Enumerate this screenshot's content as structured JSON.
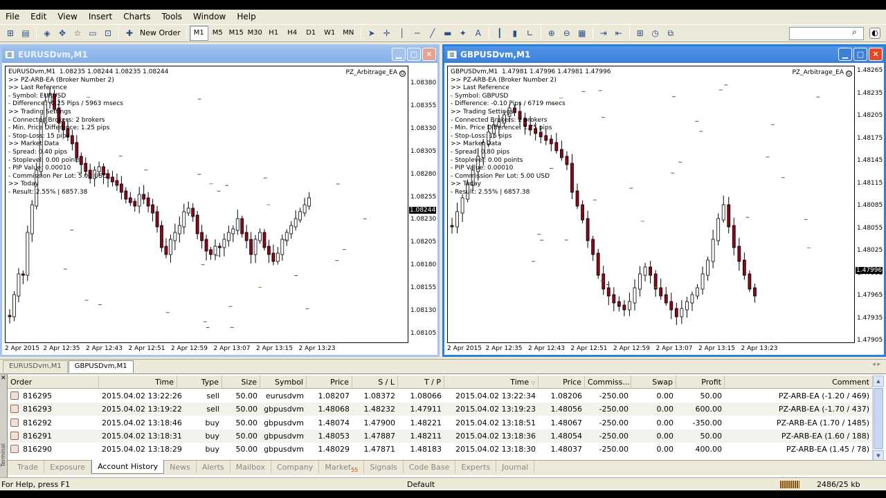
{
  "menu": [
    "File",
    "Edit",
    "View",
    "Insert",
    "Charts",
    "Tools",
    "Window",
    "Help"
  ],
  "toolbar": {
    "new_order_label": "New Order",
    "timeframes": [
      "M1",
      "M5",
      "M15",
      "M30",
      "H1",
      "H4",
      "D1",
      "W1",
      "MN"
    ],
    "active_timeframe": "M1",
    "text_tool": "A"
  },
  "windows": {
    "left": {
      "title": "EURUSDvm,M1",
      "header": "EURUSDvm,M1  1.08235 1.08244 1.08235 1.08244",
      "ea": "PZ_Arbitrage_EA",
      "info": [
        ">> PZ-ARB-EA (Broker Number 2)",
        ">> Last Reference",
        "- Symbol: EURUSD",
        "- Difference: -0.25 Pips / 5963 msecs",
        ">> Trading Settings",
        "- Connected Brokers: 2 brokers",
        "- Min. Price Difference: 1.25 pips",
        "- Stop-Loss: 15 pips",
        ">> Market Data",
        "- Spread: 0.40 pips",
        "- Stoplevel: 0.00 points",
        "- PIP Value: 0.00010",
        "- Commission Per Lot: 5.00 USD",
        ">> Today",
        "- Result: 2.55% | 6857.38"
      ],
      "price_ticks": [
        "1.08380",
        "1.08355",
        "1.08330",
        "1.08305",
        "1.08280",
        "1.08255",
        "1.08230",
        "1.08205",
        "1.08180",
        "1.08155",
        "1.08130",
        "1.08105"
      ],
      "current_price": "1.08244",
      "time_ticks": [
        "2 Apr 2015",
        "2 Apr 12:35",
        "2 Apr 12:43",
        "2 Apr 12:51",
        "2 Apr 12:59",
        "2 Apr 13:07",
        "2 Apr 13:15",
        "2 Apr 13:23"
      ]
    },
    "right": {
      "title": "GBPUSDvm,M1",
      "header": "GBPUSDvm,M1  1.47981 1.47996 1.47981 1.47996",
      "ea": "PZ_Arbitrage_EA",
      "info": [
        ">> PZ-ARB-EA (Broker Number 2)",
        ">> Last Reference",
        "- Symbol: GBPUSD",
        "- Difference: -0.10 Pips / 6719 msecs",
        ">> Trading Settings",
        "- Connected Brokers: 2 brokers",
        "- Min. Price Difference: 1.75 pips",
        "- Stop-Loss: 15 pips",
        ">> Market Data",
        "- Spread: 0.80 pips",
        "- Stoplevel: 0.00 points",
        "- PIP Value: 0.00010",
        "- Commission Per Lot: 5.00 USD",
        ">> Today",
        "- Result: 2.55% | 6857.38"
      ],
      "price_ticks": [
        "1.48265",
        "1.48235",
        "1.48205",
        "1.48175",
        "1.48145",
        "1.48115",
        "1.48085",
        "1.48055",
        "1.48025",
        "1.47995",
        "1.47965",
        "1.47935",
        "1.47905"
      ],
      "current_price": "1.47996",
      "time_ticks": [
        "2 Apr 2015",
        "2 Apr 12:35",
        "2 Apr 12:43",
        "2 Apr 12:51",
        "2 Apr 12:59",
        "2 Apr 13:07",
        "2 Apr 13:15",
        "2 Apr 13:23"
      ]
    }
  },
  "chart_tabs": [
    "EURUSDvm,M1",
    "GBPUSDvm,M1"
  ],
  "active_chart_tab": "GBPUSDvm,M1",
  "terminal": {
    "side_label": "Terminal",
    "columns": [
      "Order",
      "Time",
      "Type",
      "Size",
      "Symbol",
      "Price",
      "S / L",
      "T / P",
      "Time",
      "Price",
      "Commiss...",
      "Swap",
      "Profit",
      "Comment"
    ],
    "rows": [
      [
        "816295",
        "2015.04.02 13:22:26",
        "sell",
        "50.00",
        "eurusdvm",
        "1.08207",
        "1.08372",
        "1.08066",
        "2015.04.02 13:22:34",
        "1.08206",
        "-250.00",
        "0.00",
        "50.00",
        "PZ-ARB-EA (-1.20 / 469)"
      ],
      [
        "816293",
        "2015.04.02 13:19:22",
        "sell",
        "50.00",
        "gbpusdvm",
        "1.48068",
        "1.48232",
        "1.47911",
        "2015.04.02 13:19:23",
        "1.48056",
        "-250.00",
        "0.00",
        "600.00",
        "PZ-ARB-EA (-1.70 / 437)"
      ],
      [
        "816292",
        "2015.04.02 13:18:46",
        "buy",
        "50.00",
        "gbpusdvm",
        "1.48074",
        "1.47900",
        "1.48221",
        "2015.04.02 13:18:51",
        "1.48067",
        "-250.00",
        "0.00",
        "-350.00",
        "PZ-ARB-EA (1.70 / 1485)"
      ],
      [
        "816291",
        "2015.04.02 13:18:31",
        "buy",
        "50.00",
        "gbpusdvm",
        "1.48053",
        "1.47887",
        "1.48211",
        "2015.04.02 13:18:36",
        "1.48054",
        "-250.00",
        "0.00",
        "50.00",
        "PZ-ARB-EA (1.60 / 188)"
      ],
      [
        "816290",
        "2015.04.02 13:18:29",
        "buy",
        "50.00",
        "gbpusdvm",
        "1.48029",
        "1.47871",
        "1.48183",
        "2015.04.02 13:18:30",
        "1.48037",
        "-250.00",
        "0.00",
        "400.00",
        "PZ-ARB-EA (1.45 / 78)"
      ]
    ],
    "tabs": [
      "Trade",
      "Exposure",
      "Account History",
      "News",
      "Alerts",
      "Mailbox",
      "Company",
      "Market",
      "Signals",
      "Code Base",
      "Experts",
      "Journal"
    ],
    "market_badge": "55",
    "active_tab": "Account History"
  },
  "status": {
    "help": "For Help, press F1",
    "profile": "Default",
    "traffic": "2486/25 kb"
  },
  "colors": {
    "bull": "#ffffff",
    "bear": "#8b0a1a",
    "titlebar_active": "#3c7fd9"
  }
}
